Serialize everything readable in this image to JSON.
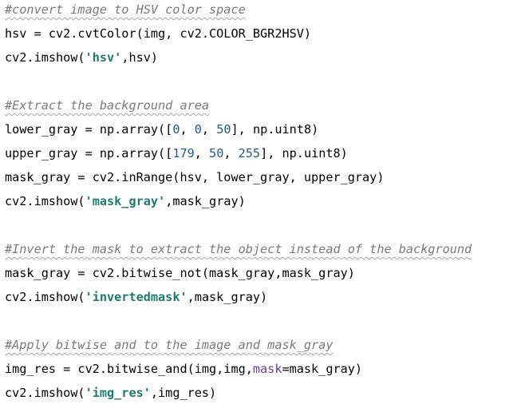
{
  "code": {
    "lines": [
      {
        "tokens": [
          {
            "text": "#convert image to HSV color space",
            "kind": "comment"
          }
        ]
      },
      {
        "tokens": [
          {
            "text": "hsv = cv2.cvtColor(img, cv2.COLOR_BGR2HSV)",
            "kind": "plain"
          }
        ]
      },
      {
        "tokens": [
          {
            "text": "cv2.imshow(",
            "kind": "plain"
          },
          {
            "text": "'hsv'",
            "kind": "string"
          },
          {
            "text": ",hsv)",
            "kind": "plain"
          }
        ]
      },
      {
        "tokens": [
          {
            "text": "#Extract the background area",
            "kind": "comment"
          }
        ]
      },
      {
        "tokens": [
          {
            "text": "lower_gray = np.array([",
            "kind": "plain"
          },
          {
            "text": "0",
            "kind": "number"
          },
          {
            "text": ", ",
            "kind": "plain"
          },
          {
            "text": "0",
            "kind": "number"
          },
          {
            "text": ", ",
            "kind": "plain"
          },
          {
            "text": "50",
            "kind": "number"
          },
          {
            "text": "], np.uint8)",
            "kind": "plain"
          }
        ]
      },
      {
        "tokens": [
          {
            "text": "upper_gray = np.array([",
            "kind": "plain"
          },
          {
            "text": "179",
            "kind": "number"
          },
          {
            "text": ", ",
            "kind": "plain"
          },
          {
            "text": "50",
            "kind": "number"
          },
          {
            "text": ", ",
            "kind": "plain"
          },
          {
            "text": "255",
            "kind": "number"
          },
          {
            "text": "], np.uint8)",
            "kind": "plain"
          }
        ]
      },
      {
        "tokens": [
          {
            "text": "mask_gray = cv2.inRange(hsv, lower_gray, upper_gray)",
            "kind": "plain"
          }
        ]
      },
      {
        "tokens": [
          {
            "text": "cv2.imshow(",
            "kind": "plain"
          },
          {
            "text": "'mask_gray'",
            "kind": "string"
          },
          {
            "text": ",mask_gray)",
            "kind": "plain"
          }
        ]
      },
      {
        "tokens": [
          {
            "text": "#Invert the mask to extract the object instead of the background",
            "kind": "comment"
          }
        ]
      },
      {
        "tokens": [
          {
            "text": "mask_gray = cv2.bitwise_not(mask_gray,mask_gray)",
            "kind": "plain"
          }
        ]
      },
      {
        "tokens": [
          {
            "text": "cv2.imshow(",
            "kind": "plain"
          },
          {
            "text": "'invertedmask'",
            "kind": "string"
          },
          {
            "text": ",mask_gray)",
            "kind": "plain"
          }
        ]
      },
      {
        "tokens": [
          {
            "text": "#Apply bitwise and to the image and mask_gray",
            "kind": "comment"
          }
        ]
      },
      {
        "tokens": [
          {
            "text": "img_res = cv2.bitwise_and(img,img,",
            "kind": "plain"
          },
          {
            "text": "mask",
            "kind": "keyword"
          },
          {
            "text": "=mask_gray)",
            "kind": "plain"
          }
        ]
      },
      {
        "tokens": [
          {
            "text": "cv2.imshow(",
            "kind": "plain"
          },
          {
            "text": "'img_res'",
            "kind": "string"
          },
          {
            "text": ",img_res)",
            "kind": "plain"
          }
        ]
      }
    ]
  },
  "colors": {
    "comment": "#7a7a7a",
    "string": "#1f7a74",
    "number": "#245a91",
    "keyword": "#6d3d9f",
    "text": "#000000",
    "background": "#ffffff"
  }
}
